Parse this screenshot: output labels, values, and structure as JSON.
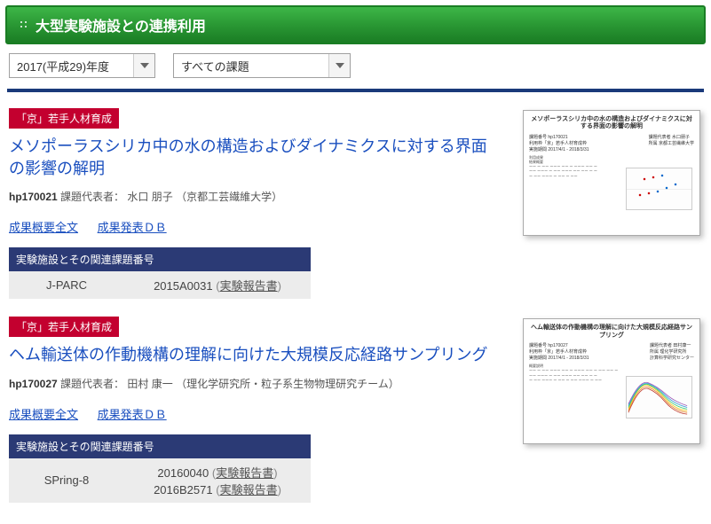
{
  "header": {
    "title": "大型実験施設との連携利用"
  },
  "filters": {
    "year": {
      "selected": "2017(平成29)年度"
    },
    "category": {
      "selected": "すべての課題"
    }
  },
  "entries": [
    {
      "badge": "「京」若手人材育成",
      "title": "メソポーラスシリカ中の水の構造およびダイナミクスに対する界面の影響の解明",
      "code": "hp170021",
      "rep_label": "課題代表者：",
      "rep_name": "水口 朋子",
      "rep_affil": "（京都工芸繊維大学）",
      "link_full": "成果概要全文",
      "link_db": "成果発表ＤＢ",
      "table_header": "実験施設とその関連課題番号",
      "facility": "J-PARC",
      "related_ids": [
        "2015A0031"
      ],
      "report_label": "実験報告書",
      "thumb_title": "メソポーラスシリカ中の水の構造およびダイナミクスに対する界面の影響の解明"
    },
    {
      "badge": "「京」若手人材育成",
      "title": "ヘム輸送体の作動機構の理解に向けた大規模反応経路サンプリング",
      "code": "hp170027",
      "rep_label": "課題代表者：",
      "rep_name": "田村 康一",
      "rep_affil": "（理化学研究所・粒子系生物物理研究チーム）",
      "link_full": "成果概要全文",
      "link_db": "成果発表ＤＢ",
      "table_header": "実験施設とその関連課題番号",
      "facility": "SPring-8",
      "related_ids": [
        "20160040",
        "2016B2571"
      ],
      "report_label": "実験報告書",
      "thumb_title": "ヘム輸送体の作動機構の理解に向けた大規模反応経路サンプリング"
    }
  ]
}
